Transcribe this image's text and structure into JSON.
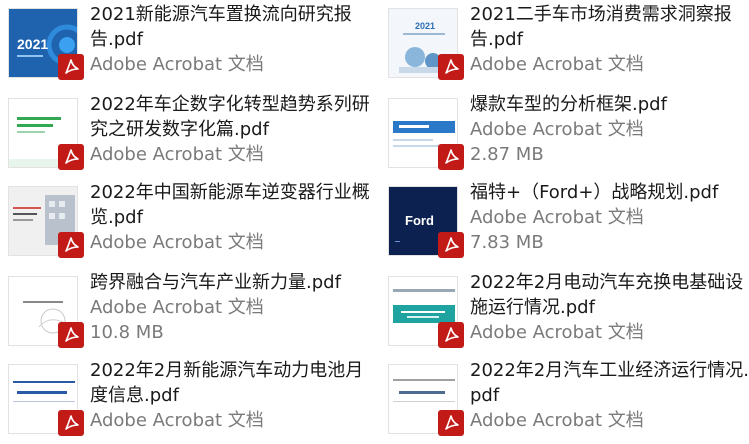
{
  "files": [
    {
      "title": "2021新能源汽车置换流向研究报告.pdf",
      "app": "Adobe Acrobat 文档",
      "size": "",
      "thumb": "dark-blue-2021"
    },
    {
      "title": "2021二手车市场消费需求洞察报告.pdf",
      "app": "Adobe Acrobat 文档",
      "size": "",
      "thumb": "light-cover-2021"
    },
    {
      "title": "2022年车企数字化转型趋势系列研究之研发数字化篇.pdf",
      "app": "Adobe Acrobat 文档",
      "size": "",
      "thumb": "green-white"
    },
    {
      "title": "爆款车型的分析框架.pdf",
      "app": "Adobe Acrobat 文档",
      "size": "2.87 MB",
      "thumb": "blue-banner"
    },
    {
      "title": "2022年中国新能源车逆变器行业概览.pdf",
      "app": "Adobe Acrobat 文档",
      "size": "",
      "thumb": "building-photo"
    },
    {
      "title": "福特+（Ford+）战略规划.pdf",
      "app": "Adobe Acrobat 文档",
      "size": "7.83 MB",
      "thumb": "ford-navy"
    },
    {
      "title": "跨界融合与汽车产业新力量.pdf",
      "app": "Adobe Acrobat 文档",
      "size": "10.8 MB",
      "thumb": "white-sketch"
    },
    {
      "title": "2022年2月电动汽车充换电基础设施运行情况.pdf",
      "app": "Adobe Acrobat 文档",
      "size": "",
      "thumb": "teal-banner"
    },
    {
      "title": "2022年2月新能源汽车动力电池月度信息.pdf",
      "app": "Adobe Acrobat 文档",
      "size": "",
      "thumb": "white-blue-lines"
    },
    {
      "title": "2022年2月汽车工业经济运行情况.pdf",
      "app": "Adobe Acrobat 文档",
      "size": "",
      "thumb": "white-gray-report"
    }
  ],
  "thumb_texts": {
    "year_2021": "2021",
    "ford": "Ford"
  }
}
